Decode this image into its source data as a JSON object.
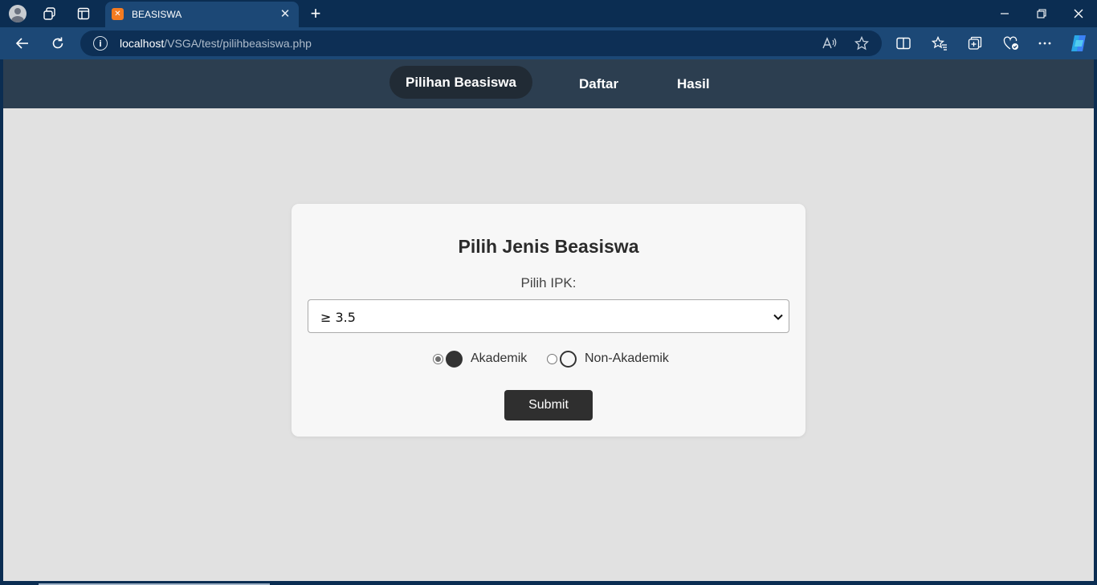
{
  "browser": {
    "tab": {
      "title": "BEASISWA"
    },
    "address": {
      "host": "localhost",
      "path": "/VSGA/test/pilihbeasiswa.php"
    }
  },
  "site": {
    "nav": [
      {
        "label": "Pilihan Beasiswa",
        "active": true
      },
      {
        "label": "Daftar",
        "active": false
      },
      {
        "label": "Hasil",
        "active": false
      }
    ]
  },
  "form": {
    "title": "Pilih Jenis Beasiswa",
    "ipk_label": "Pilih IPK:",
    "ipk_selected": "≥ 3.5",
    "options": [
      {
        "label": "Akademik",
        "checked": true
      },
      {
        "label": "Non-Akademik",
        "checked": false
      }
    ],
    "submit_label": "Submit"
  }
}
